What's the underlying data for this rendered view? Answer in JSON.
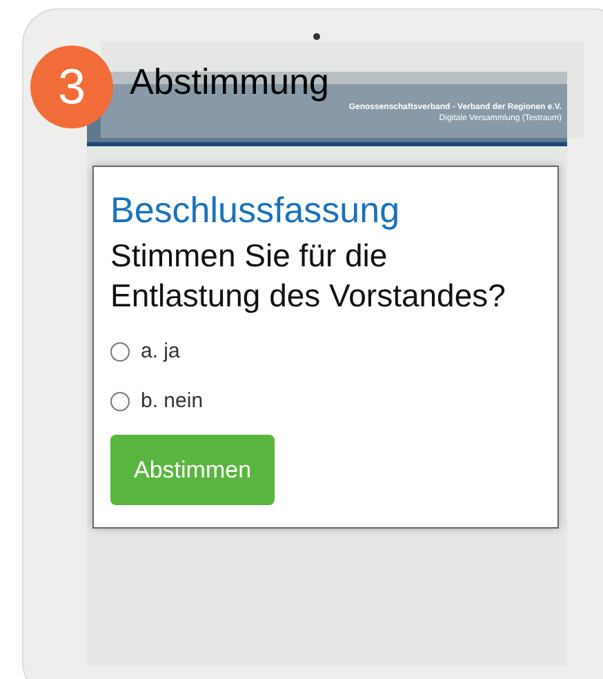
{
  "step": {
    "number": "3",
    "title": "Abstimmung"
  },
  "header": {
    "organization": "Genossenschaftsverband - Verband der Regionen e.V.",
    "subtitle": "Digitale Versammlung (Testraum)"
  },
  "card": {
    "heading": "Beschlussfassung",
    "question": "Stimmen Sie für die Entlastung des Vorstandes?",
    "options": [
      {
        "label": "a. ja",
        "selected": false
      },
      {
        "label": "b. nein",
        "selected": false
      }
    ],
    "button": "Abstimmen"
  }
}
